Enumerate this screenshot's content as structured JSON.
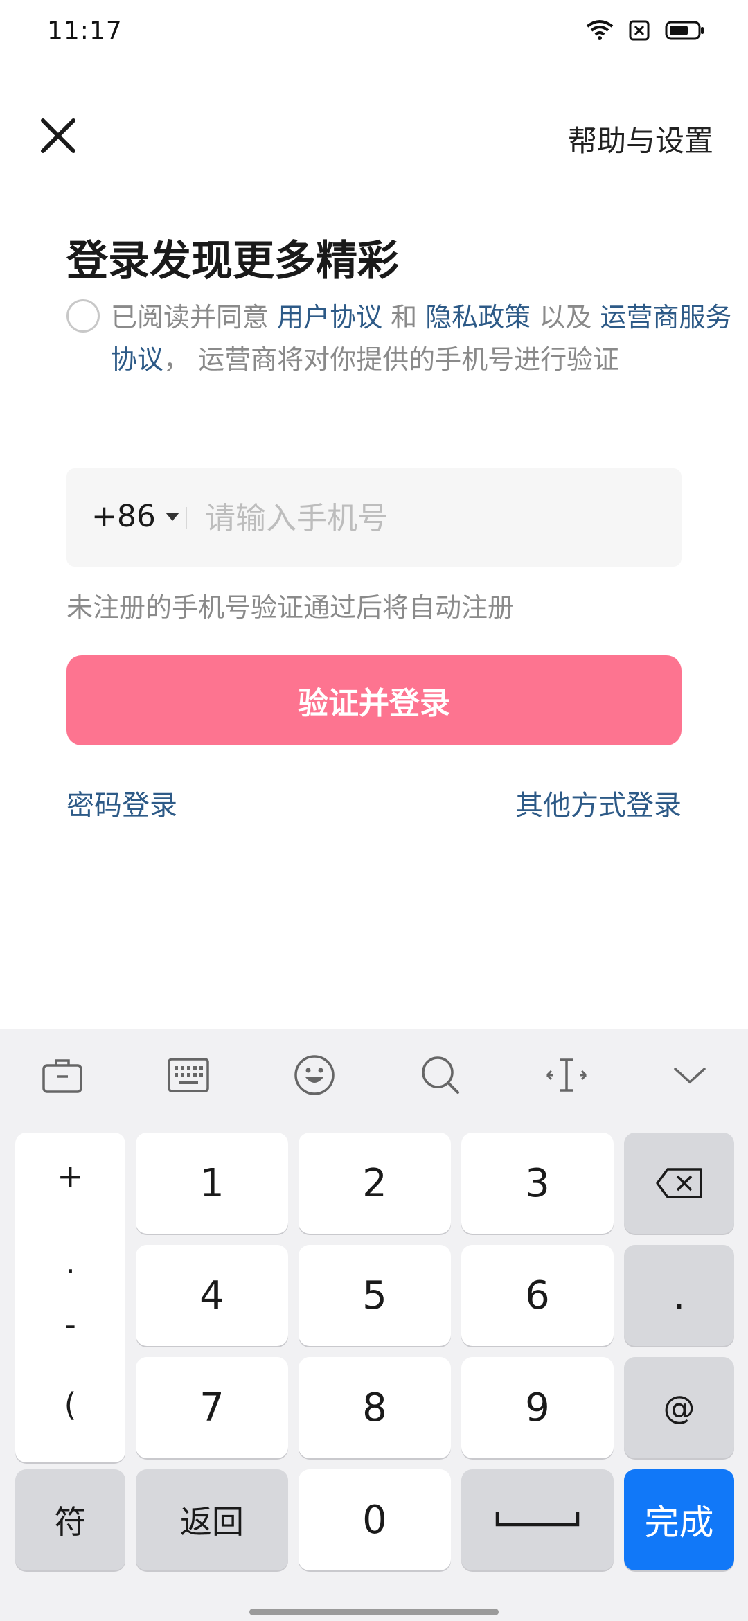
{
  "status": {
    "time": "11:17"
  },
  "header": {
    "help": "帮助与设置"
  },
  "title": "登录发现更多精彩",
  "agreement": {
    "prefix": "已阅读并同意 ",
    "user_agreement": "用户协议",
    "and": " 和 ",
    "privacy": "隐私政策",
    "also": " 以及 ",
    "carrier": "运营商服务协议",
    "suffix": "， 运营商将对你提供的手机号进行验证"
  },
  "phone": {
    "country_code": "+86",
    "placeholder": "请输入手机号"
  },
  "hint": "未注册的手机号验证通过后将自动注册",
  "login_button": "验证并登录",
  "password_login": "密码登录",
  "other_login": "其他方式登录",
  "keyboard": {
    "symbols": [
      "+",
      ".",
      "-",
      "("
    ],
    "digits": [
      "1",
      "2",
      "3",
      "4",
      "5",
      "6",
      "7",
      "8",
      "9",
      "0"
    ],
    "dot": ".",
    "at": "@",
    "fu": "符",
    "back": "返回",
    "done": "完成"
  },
  "colors": {
    "accent_pink": "#fd7490",
    "link_blue": "#2d5a87",
    "done_blue": "#1178f8"
  }
}
